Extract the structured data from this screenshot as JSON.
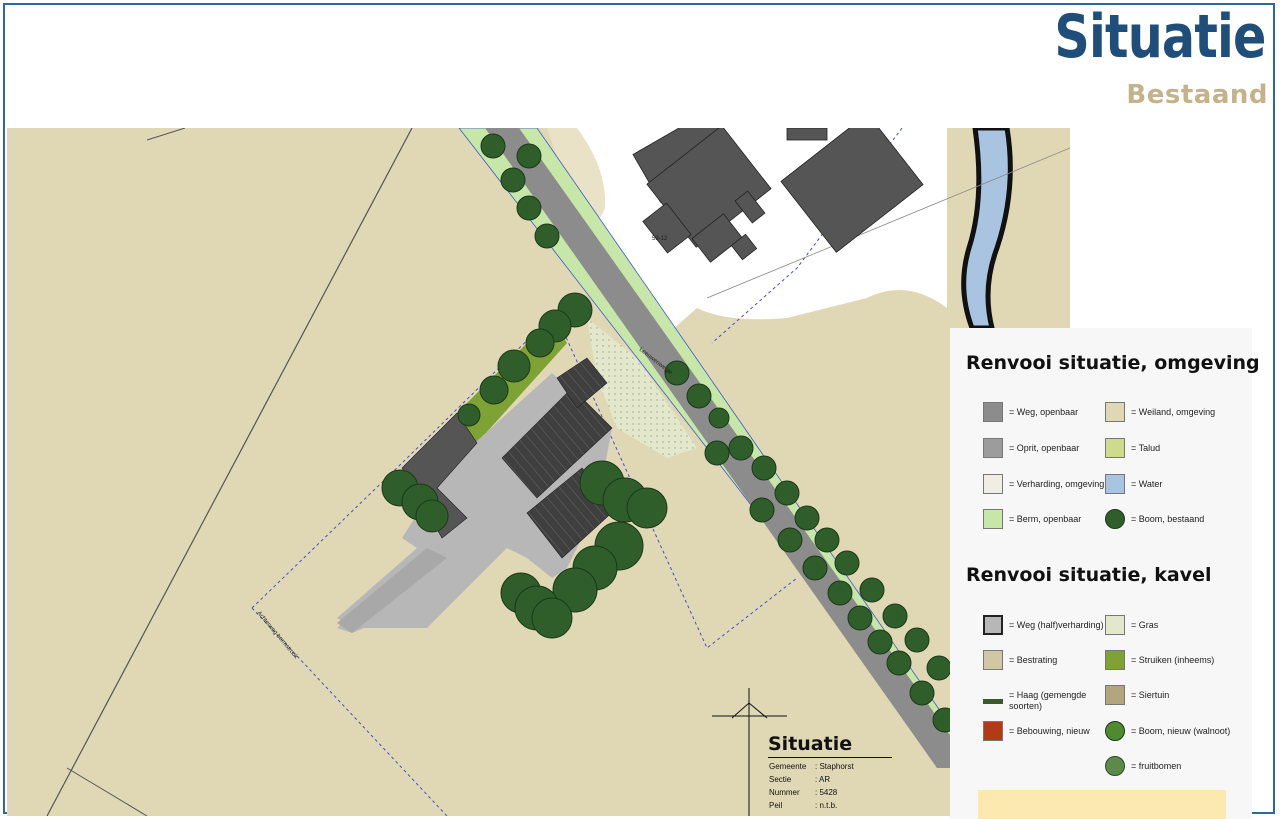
{
  "header": {
    "title": "Situatie",
    "subtitle": "Bestaand"
  },
  "map": {
    "road_label": "Leeuwenwegje",
    "building_label": "53-12",
    "plot_label": "Achterweg bermstrook"
  },
  "legend_environment": {
    "heading": "Renvooi situatie, omgeving",
    "items": [
      {
        "label": "= Weg, openbaar",
        "color": "#8c8c8c"
      },
      {
        "label": "= Weiland, omgeving",
        "color": "#e0d8b4"
      },
      {
        "label": "= Oprit, openbaar",
        "color": "#9c9c9c"
      },
      {
        "label": "= Talud",
        "color": "#cddb8a"
      },
      {
        "label": "= Verharding, omgeving",
        "color": "#efede4"
      },
      {
        "label": "= Water",
        "color": "#a9c4e0"
      },
      {
        "label": "= Berm, openbaar",
        "color": "#c7e7a8"
      },
      {
        "label": "= Boom, bestaand",
        "color": "#2f5e2a"
      }
    ]
  },
  "legend_plot": {
    "heading": "Renvooi situatie, kavel",
    "items": [
      {
        "label": "= Weg (half)verharding)",
        "color": "#b7b7b7"
      },
      {
        "label": "= Gras",
        "color": "#e3e8cc"
      },
      {
        "label": "= Bestrating",
        "color": "#d2c7a4"
      },
      {
        "label": "= Struiken (inheems)",
        "color": "#7ea234"
      },
      {
        "label": "= Haag (gemengde soorten)",
        "color": "#3a5a2c"
      },
      {
        "label": "= Siertuin",
        "color": "#b3a57c"
      },
      {
        "label": "= Bebouwing, nieuw",
        "color": "#b33a12"
      },
      {
        "label": "= Boom, nieuw (walnoot)",
        "color": "#4f8a2e"
      },
      {
        "label": "= fruitbomen",
        "color": "#5b8a4a"
      }
    ]
  },
  "situation_box": {
    "title": "Situatie",
    "rows": [
      {
        "key": "Gemeente",
        "value": ": Staphorst"
      },
      {
        "key": "Sectie",
        "value": ": AR"
      },
      {
        "key": "Nummer",
        "value": ": 5428"
      },
      {
        "key": "Peil",
        "value": ": n.t.b."
      }
    ]
  },
  "colors": {
    "frame": "#2a6aa0",
    "title": "#1f4e7a",
    "subtitle": "#c3b28a",
    "meadow": "#e0d8b4",
    "road": "#8c8c8c",
    "tree": "#2f5e2a",
    "water": "#a9c4e0"
  }
}
